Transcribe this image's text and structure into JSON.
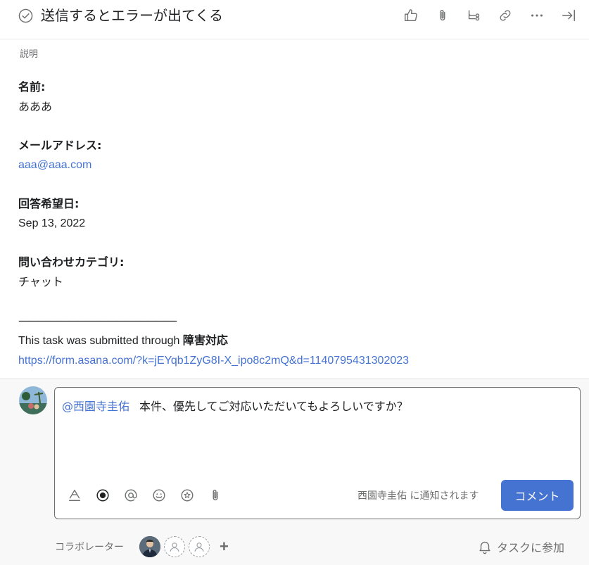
{
  "task": {
    "title": "送信するとエラーが出てくる"
  },
  "header": {
    "icons": [
      "like-icon",
      "attach-icon",
      "subtask-icon",
      "link-icon",
      "more-icon",
      "close-panel-icon"
    ]
  },
  "description": {
    "label": "説明",
    "fields": [
      {
        "label": "名前:",
        "value": "あああ"
      },
      {
        "label": "メールアドレス:",
        "value": "aaa@aaa.com"
      },
      {
        "label": "回答希望日:",
        "value": "Sep 13, 2022"
      },
      {
        "label": "問い合わせカテゴリ:",
        "value": "チャット"
      }
    ],
    "divider": "————————————————",
    "submitted_prefix": "This task was submitted through ",
    "submitted_form": "障害対応",
    "form_url": "https://form.asana.com/?k=jEYqb1ZyG8I-X_ipo8c2mQ&d=1140795431302023"
  },
  "comment": {
    "mention": "@西園寺圭佑",
    "text": "本件、優先してご対応いただいてもよろしいですか？",
    "notify": "西園寺圭佑 に通知されます",
    "submit_label": "コメント"
  },
  "collaborators": {
    "label": "コラボレーター",
    "add": "+",
    "join_label": "タスクに参加"
  },
  "colors": {
    "accent": "#4573d2",
    "text": "#1e1f21",
    "muted": "#6d6e6f"
  }
}
